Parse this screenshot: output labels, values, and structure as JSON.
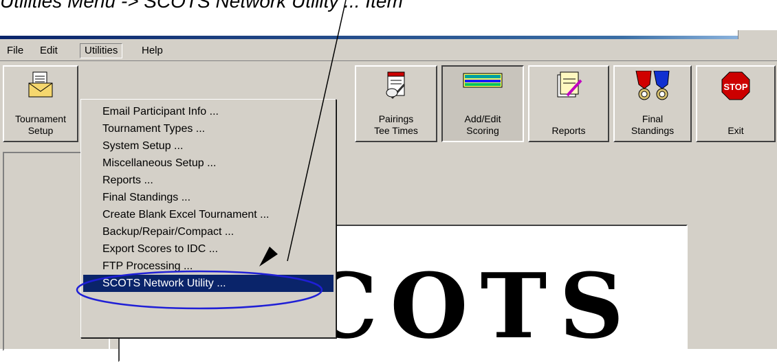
{
  "caption": "Utilities Menu -> SCOTS Network Utility ... Item",
  "menubar": {
    "items": [
      {
        "label": "File"
      },
      {
        "label": "Edit"
      },
      {
        "label": "Utilities"
      },
      {
        "label": "Help"
      }
    ]
  },
  "toolbar": {
    "buttons": [
      {
        "label": "Tournament\nSetup",
        "icon": "tournament-envelope-icon"
      },
      {
        "label": "Pairings\nTee Times",
        "icon": "pairings-notepad-icon"
      },
      {
        "label": "Add/Edit\nScoring",
        "icon": "scorecard-grid-icon"
      },
      {
        "label": "Reports",
        "icon": "reports-pencil-icon"
      },
      {
        "label": "Final\nStandings",
        "icon": "medals-icon"
      },
      {
        "label": "Exit",
        "icon": "stop-sign-icon"
      }
    ]
  },
  "dropdown": {
    "items": [
      "Email Participant Info ...",
      "Tournament Types ...",
      "System Setup ...",
      "Miscellaneous Setup ...",
      "Reports ...",
      "Final Standings ...",
      "Create Blank Excel Tournament ...",
      "Backup/Repair/Compact ...",
      "Export Scores to IDC ...",
      "FTP Processing ...",
      "SCOTS Network Utility ..."
    ],
    "highlighted": "SCOTS Network Utility ..."
  },
  "splash": {
    "logo_text": "SCOTS"
  },
  "colors": {
    "menu_highlight": "#0a246a",
    "annotation_ellipse": "#1f1fd6",
    "stop_red": "#cc0000"
  }
}
